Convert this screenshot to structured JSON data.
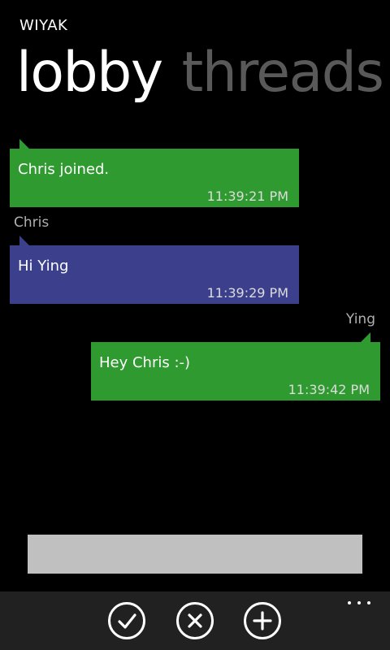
{
  "app": {
    "title": "WIYAK"
  },
  "pivot": {
    "active": "lobby",
    "inactive": "threads"
  },
  "colors": {
    "incoming_system": "#2f9a2f",
    "incoming_user": "#3b3f8c",
    "outgoing": "#2f9a2f",
    "app_bar": "#212121",
    "compose_box": "#c0c0c0"
  },
  "messages": [
    {
      "sender": "",
      "text": "Chris joined.",
      "time": "11:39:21 PM",
      "direction": "incoming"
    },
    {
      "sender": "Chris",
      "text": "Hi Ying",
      "time": "11:39:29 PM",
      "direction": "incoming"
    },
    {
      "sender": "Ying",
      "text": "Hey Chris :-)",
      "time": "11:39:42 PM",
      "direction": "outgoing"
    }
  ],
  "compose": {
    "value": "",
    "placeholder": ""
  },
  "app_bar": {
    "buttons": [
      {
        "icon": "check-icon"
      },
      {
        "icon": "close-icon"
      },
      {
        "icon": "add-icon"
      }
    ],
    "more_icon": "more-dots-icon"
  }
}
